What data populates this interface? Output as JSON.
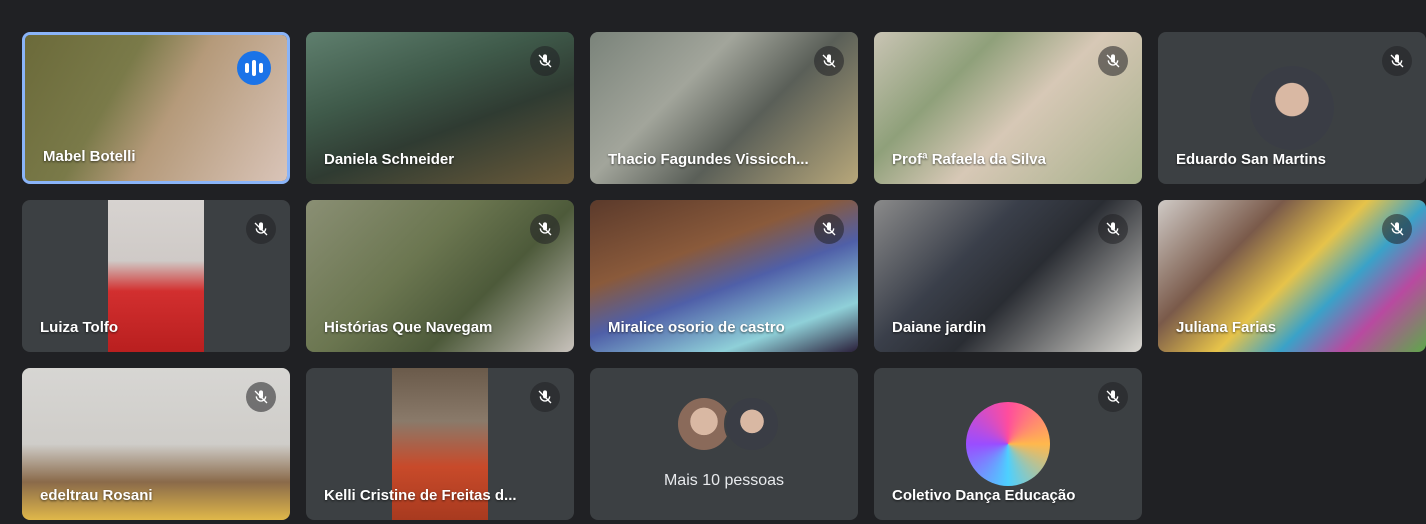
{
  "participants": [
    {
      "name": "Mabel Botelli",
      "speaking": true
    },
    {
      "name": "Daniela Schneider",
      "muted": true
    },
    {
      "name": "Thacio Fagundes Vissicch...",
      "muted": true
    },
    {
      "name": "Profª Rafaela da Silva",
      "muted": true
    },
    {
      "name": "Eduardo San Martins",
      "muted": true
    },
    {
      "name": "Luiza Tolfo",
      "muted": true
    },
    {
      "name": "Histórias Que Navegam",
      "muted": true
    },
    {
      "name": "Miralice osorio de castro",
      "muted": true
    },
    {
      "name": "Daiane jardin",
      "muted": true
    },
    {
      "name": "Juliana Farias",
      "muted": true
    },
    {
      "name": "edeltrau Rosani",
      "muted": true
    },
    {
      "name": "Kelli Cristine de Freitas d...",
      "muted": true
    },
    {
      "name": "Coletivo Dança Educação",
      "muted": true
    }
  ],
  "more_people": {
    "label": "Mais 10 pessoas"
  },
  "colors": {
    "background": "#202124",
    "tile": "#3c4043",
    "active_border": "#8ab4f8",
    "speaking": "#1a73e8"
  },
  "icons": {
    "muted": "mic-off-icon",
    "speaking": "audio-level-icon"
  }
}
